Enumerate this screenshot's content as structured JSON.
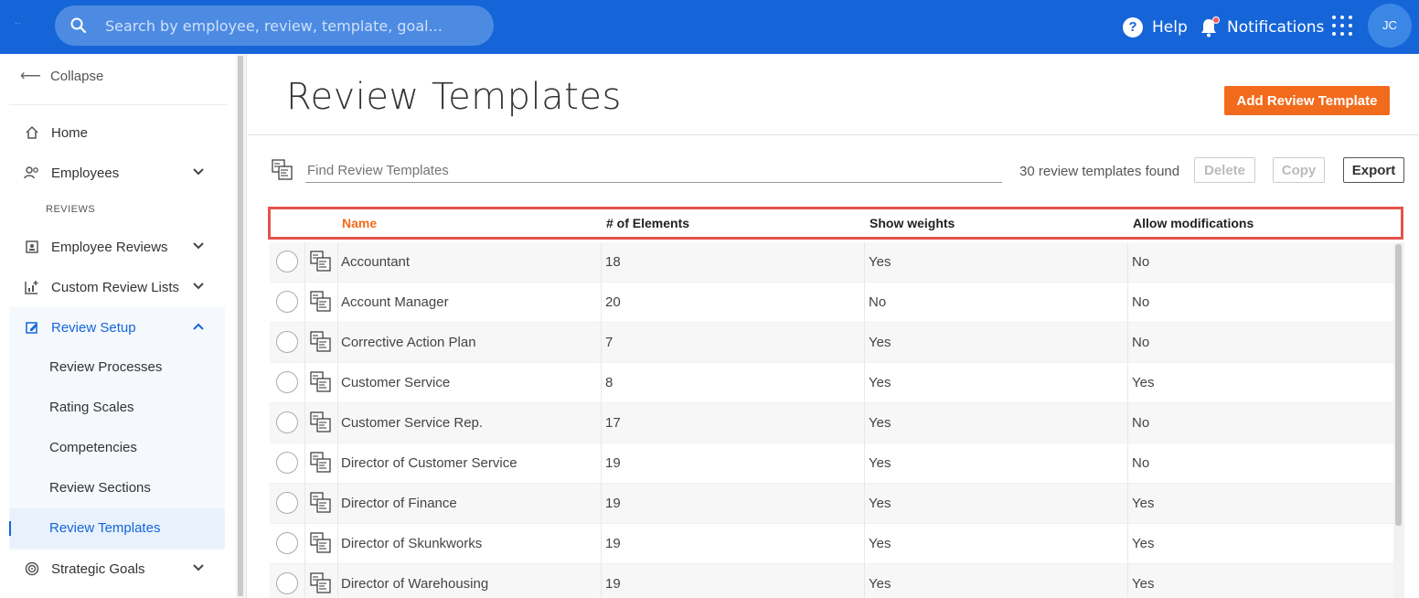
{
  "search": {
    "placeholder": "Search by employee, review, template, goal..."
  },
  "topbar": {
    "help_label": "Help",
    "notifications_label": "Notifications",
    "avatar_initials": "JC"
  },
  "sidebar": {
    "collapse_label": "Collapse",
    "home": "Home",
    "employees": "Employees",
    "section_label": "REVIEWS",
    "employee_reviews": "Employee Reviews",
    "custom_review_lists": "Custom Review Lists",
    "review_setup": "Review Setup",
    "sub_items": [
      "Review Processes",
      "Rating Scales",
      "Competencies",
      "Review Sections",
      "Review Templates"
    ],
    "strategic_goals": "Strategic Goals"
  },
  "main": {
    "title": "Review Templates",
    "add_button": "Add Review Template",
    "find_placeholder": "Find Review Templates",
    "found_text": "30 review templates found",
    "delete_label": "Delete",
    "copy_label": "Copy",
    "export_label": "Export"
  },
  "table": {
    "headers": {
      "name": "Name",
      "elements": "# of Elements",
      "weights": "Show weights",
      "mods": "Allow modifications"
    },
    "rows": [
      {
        "name": "Accountant",
        "elements": "18",
        "weights": "Yes",
        "mods": "No"
      },
      {
        "name": "Account Manager",
        "elements": "20",
        "weights": "No",
        "mods": "No"
      },
      {
        "name": "Corrective Action Plan",
        "elements": "7",
        "weights": "Yes",
        "mods": "No"
      },
      {
        "name": "Customer Service",
        "elements": "8",
        "weights": "Yes",
        "mods": "Yes"
      },
      {
        "name": "Customer Service Rep.",
        "elements": "17",
        "weights": "Yes",
        "mods": "No"
      },
      {
        "name": "Director of Customer Service",
        "elements": "19",
        "weights": "Yes",
        "mods": "No"
      },
      {
        "name": "Director of Finance",
        "elements": "19",
        "weights": "Yes",
        "mods": "Yes"
      },
      {
        "name": "Director of Skunkworks",
        "elements": "19",
        "weights": "Yes",
        "mods": "Yes"
      },
      {
        "name": "Director of Warehousing",
        "elements": "19",
        "weights": "Yes",
        "mods": "Yes"
      }
    ]
  },
  "colors": {
    "primary": "#1565d8",
    "accent": "#f26b1d",
    "highlight": "#e5534b"
  }
}
